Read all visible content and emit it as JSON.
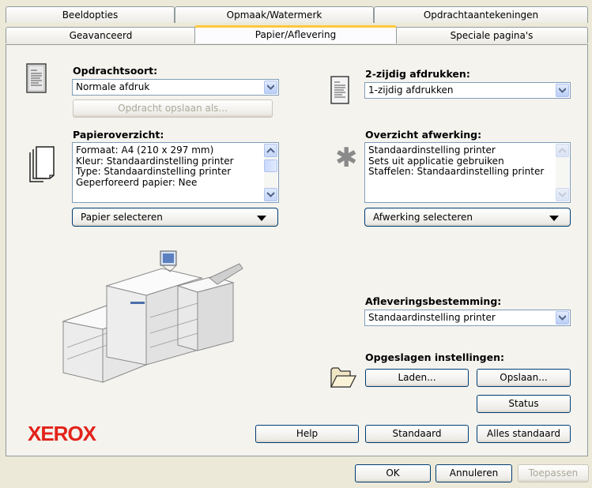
{
  "tabs_row1": [
    "Beeldopties",
    "Opmaak/Watermerk",
    "Opdrachtaantekeningen"
  ],
  "tabs_row2": [
    "Geavanceerd",
    "Papier/Aflevering",
    "Speciale pagina's"
  ],
  "job_type": {
    "label": "Opdrachtsoort:",
    "value": "Normale afdruk",
    "save_button": "Opdracht opslaan als..."
  },
  "paper": {
    "label": "Papieroverzicht:",
    "lines": [
      "Formaat: A4 (210 x 297 mm)",
      "Kleur: Standaardinstelling printer",
      "Type: Standaardinstelling printer",
      "Geperforeerd papier: Nee"
    ],
    "select_button": "Papier selecteren"
  },
  "duplex": {
    "label": "2-zijdig afdrukken:",
    "value": "1-zijdig afdrukken"
  },
  "finishing": {
    "label": "Overzicht afwerking:",
    "lines": [
      "Standaardinstelling printer",
      "Sets uit applicatie gebruiken",
      "Staffelen: Standaardinstelling printer"
    ],
    "select_button": "Afwerking selecteren"
  },
  "destination": {
    "label": "Afleveringsbestemming:",
    "value": "Standaardinstelling printer"
  },
  "saved": {
    "label": "Opgeslagen instellingen:",
    "load": "Laden...",
    "save": "Opslaan...",
    "status": "Status"
  },
  "bottom": {
    "logo": "XEROX",
    "help": "Help",
    "default": "Standaard",
    "all_default": "Alles standaard"
  },
  "dialog": {
    "ok": "OK",
    "cancel": "Annuleren",
    "apply": "Toepassen"
  },
  "colors": {
    "brand": "#e2231a",
    "tab_highlight": "#ffc73c",
    "button_border": "#003c74"
  }
}
